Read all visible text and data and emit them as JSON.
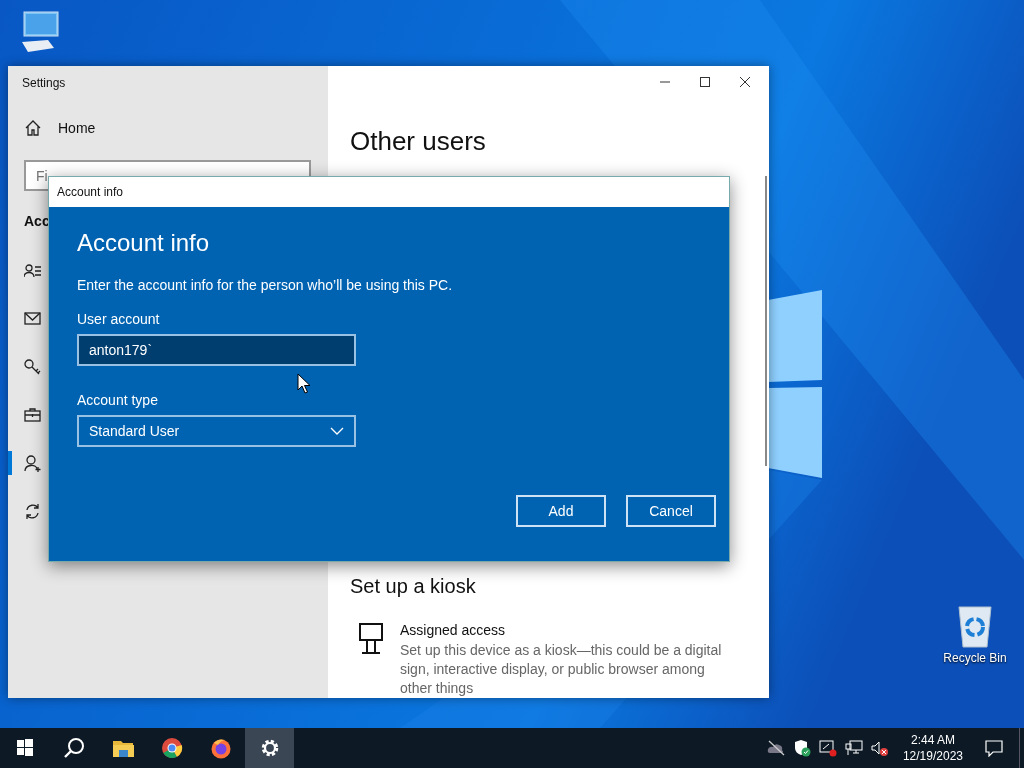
{
  "desktop": {
    "icons": [
      {
        "kind": "computer"
      },
      {
        "kind": "recycle-bin",
        "label": "Recycle Bin"
      }
    ]
  },
  "settings_window": {
    "title": "Settings",
    "home": "Home",
    "search": {
      "placeholder": "Fi"
    },
    "section_heading": "Acc",
    "nav_items": [
      {
        "kind": "people-list",
        "selected": false
      },
      {
        "kind": "mail",
        "selected": false
      },
      {
        "kind": "key",
        "selected": false
      },
      {
        "kind": "briefcase",
        "selected": false
      },
      {
        "kind": "person-add",
        "selected": true
      },
      {
        "kind": "sync",
        "selected": false
      }
    ],
    "page_title": "Other users",
    "kiosk_heading": "Set up a kiosk",
    "kiosk_item": {
      "title": "Assigned access",
      "description": "Set up this device as a kiosk—this could be a digital sign, interactive display, or public browser among other things"
    }
  },
  "dialog": {
    "title": "Account info",
    "heading": "Account info",
    "description": "Enter the account info for the person who’ll be using this PC.",
    "user_account": {
      "label": "User account",
      "value": "anton179`"
    },
    "account_type": {
      "label": "Account type",
      "value": "Standard User"
    },
    "buttons": [
      "Add",
      "Cancel"
    ]
  },
  "taskbar": {
    "apps": [
      {
        "kind": "start",
        "selected": false
      },
      {
        "kind": "search",
        "selected": false
      },
      {
        "kind": "folder",
        "selected": false
      },
      {
        "kind": "chrome",
        "selected": false
      },
      {
        "kind": "firefox",
        "selected": false
      },
      {
        "kind": "settings",
        "selected": true
      }
    ],
    "clock": {
      "time": "2:44 AM",
      "date": "12/19/2023"
    }
  }
}
